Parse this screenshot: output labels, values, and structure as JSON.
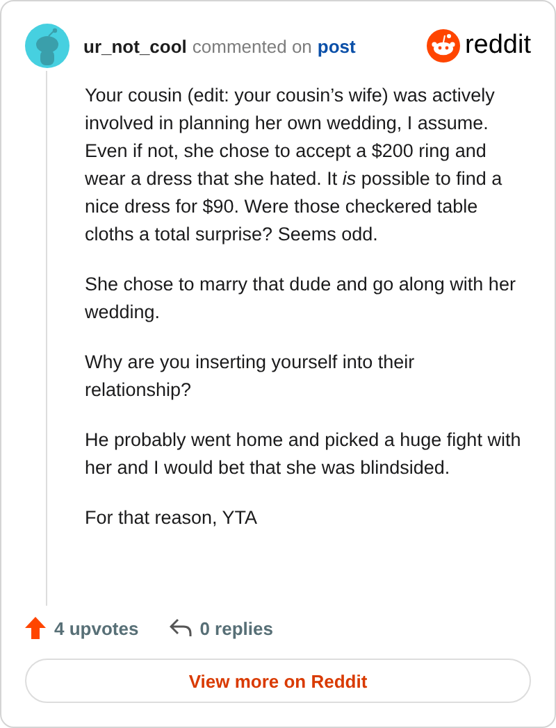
{
  "header": {
    "username": "ur_not_cool",
    "action": "commented on",
    "link": "post",
    "brand": "reddit"
  },
  "paragraphs": [
    "Your cousin (edit: your cousin’s wife) was actively involved in planning her own wedding, I assume. Even if not, she chose to accept a $200 ring and wear a dress that she hated. It *is* possible to find a nice dress for $90. Were those checkered table cloths a total surprise? Seems odd.",
    "She chose to marry that dude and go along with her wedding.",
    "Why are you inserting yourself into their relationship?",
    "He probably went home and picked a huge fight with her and I would bet that she was blindsided.",
    "For that reason, YTA"
  ],
  "footer": {
    "upvotes": "4 upvotes",
    "replies": "0 replies"
  },
  "button": "View more on Reddit"
}
